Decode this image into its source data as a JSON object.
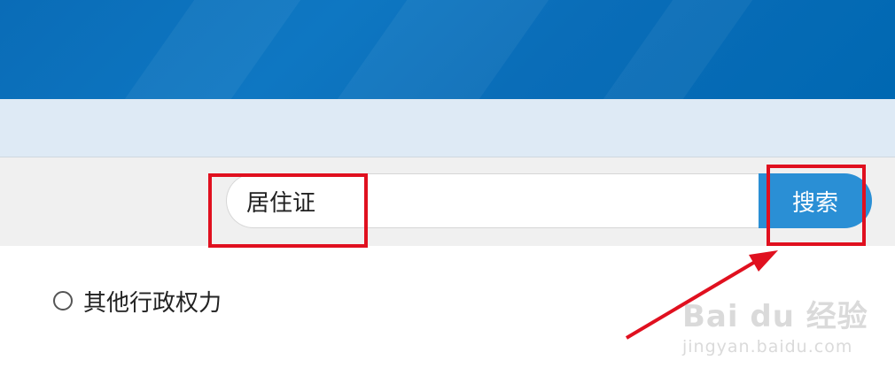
{
  "search": {
    "value": "居住证",
    "button_label": "搜索"
  },
  "options": [
    {
      "label": "其他行政权力",
      "selected": false
    }
  ],
  "watermark": {
    "brand": "Bai du 经验",
    "url": "jingyan.baidu.com"
  },
  "colors": {
    "banner": "#0a6cb7",
    "search_button": "#2a8fd5",
    "annotation": "#e0101f"
  }
}
